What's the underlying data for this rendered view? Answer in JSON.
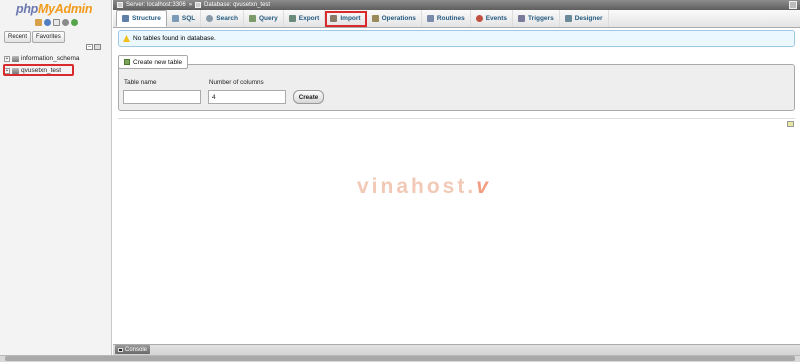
{
  "app": {
    "logo_php": "php",
    "logo_myadmin": "MyAdmin"
  },
  "nav": {
    "icons": [
      "home-icon",
      "help-icon",
      "docs-icon",
      "settings-icon",
      "reload-icon"
    ],
    "tabs": [
      {
        "label": "Recent"
      },
      {
        "label": "Favorites"
      }
    ],
    "collapse_icons": [
      "collapse-all-icon",
      "link-icon"
    ],
    "databases": [
      {
        "name": "information_schema",
        "expander": "+"
      },
      {
        "name": "qvusetxn_test",
        "expander": "+"
      }
    ]
  },
  "breadcrumb": {
    "server": "Server: localhost:3306",
    "separator": "»",
    "database": "Database: qvusetxn_test"
  },
  "tabs": [
    {
      "label": "Structure",
      "icon": "structure-icon",
      "color": "#5f7ea8"
    },
    {
      "label": "SQL",
      "icon": "sql-icon",
      "color": "#7b9ab8"
    },
    {
      "label": "Search",
      "icon": "search-icon",
      "color": "#8899aa"
    },
    {
      "label": "Query",
      "icon": "query-icon",
      "color": "#7a9a6a"
    },
    {
      "label": "Export",
      "icon": "export-icon",
      "color": "#6a8a7a"
    },
    {
      "label": "Import",
      "icon": "import-icon",
      "color": "#8a7a6a"
    },
    {
      "label": "Operations",
      "icon": "wrench-icon",
      "color": "#9a8a5a"
    },
    {
      "label": "Routines",
      "icon": "routines-icon",
      "color": "#7a8aaa"
    },
    {
      "label": "Events",
      "icon": "clock-icon",
      "color": "#c05040"
    },
    {
      "label": "Triggers",
      "icon": "triggers-icon",
      "color": "#7a7a9a"
    },
    {
      "label": "Designer",
      "icon": "designer-icon",
      "color": "#6a8a9a"
    }
  ],
  "notice": {
    "text": "No tables found in database."
  },
  "create_table": {
    "legend": "Create new table",
    "table_name_label": "Table name",
    "table_name_value": "",
    "columns_label": "Number of columns",
    "columns_value": "4",
    "button": "Create"
  },
  "watermark": {
    "text": "vinahost.",
    "mark": "v"
  },
  "console": {
    "label": "Console"
  },
  "colors": {
    "highlight": "#d92b2b",
    "tab_text": "#235a81",
    "logo_php": "#6c78af",
    "logo_myadmin": "#f29a1a"
  }
}
